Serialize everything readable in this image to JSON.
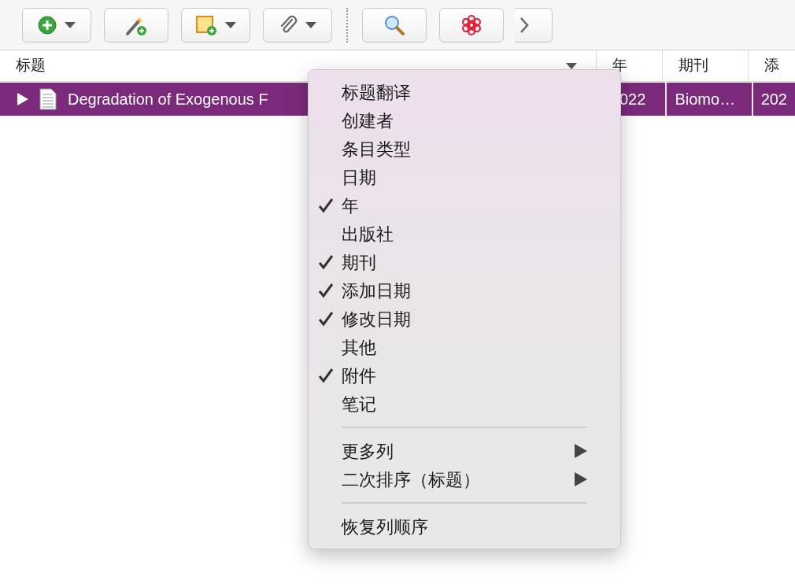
{
  "toolbar": {
    "buttons": [
      {
        "kind": "new-item",
        "has_menu": true
      },
      {
        "kind": "magic-wand",
        "has_menu": false
      },
      {
        "kind": "note",
        "has_menu": true
      },
      {
        "kind": "attachment",
        "has_menu": true
      },
      {
        "kind": "separator"
      },
      {
        "kind": "search",
        "has_menu": false
      },
      {
        "kind": "ai",
        "has_menu": false
      },
      {
        "kind": "more",
        "has_menu": false
      }
    ]
  },
  "table": {
    "columns": [
      "标题",
      "年",
      "期刊",
      "添"
    ],
    "rows": [
      {
        "selected": true,
        "expanded": false,
        "cells": [
          "Degradation of Exogenous F",
          "022",
          "Biomo…",
          "202"
        ]
      }
    ]
  },
  "context_menu": {
    "items": [
      {
        "kind": "item",
        "label": "标题翻译",
        "checked": false
      },
      {
        "kind": "item",
        "label": "创建者",
        "checked": false
      },
      {
        "kind": "item",
        "label": "条目类型",
        "checked": false
      },
      {
        "kind": "item",
        "label": "日期",
        "checked": false
      },
      {
        "kind": "item",
        "label": "年",
        "checked": true
      },
      {
        "kind": "item",
        "label": "出版社",
        "checked": false
      },
      {
        "kind": "item",
        "label": "期刊",
        "checked": true
      },
      {
        "kind": "item",
        "label": "添加日期",
        "checked": true
      },
      {
        "kind": "item",
        "label": "修改日期",
        "checked": true
      },
      {
        "kind": "item",
        "label": "其他",
        "checked": false
      },
      {
        "kind": "item",
        "label": "附件",
        "checked": true
      },
      {
        "kind": "item",
        "label": "笔记",
        "checked": false
      },
      {
        "kind": "separator"
      },
      {
        "kind": "submenu",
        "label": "更多列"
      },
      {
        "kind": "submenu",
        "label": "二次排序（标题）"
      },
      {
        "kind": "separator"
      },
      {
        "kind": "item",
        "label": "恢复列顺序",
        "checked": false
      }
    ]
  }
}
